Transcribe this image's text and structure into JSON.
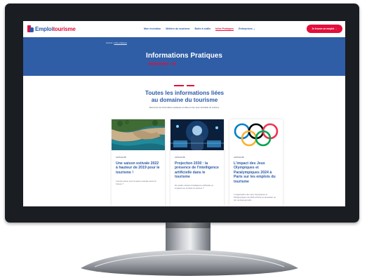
{
  "site": {
    "logo_part1": "Emploi",
    "logo_part2": "tourisme",
    "nav": [
      {
        "label": "Mon évolution"
      },
      {
        "label": "Métiers du tourisme"
      },
      {
        "label": "Boîte à outils"
      },
      {
        "label": "Infos Pratiques"
      },
      {
        "label": "Entreprises ⌄"
      }
    ],
    "cta_label": "Je trouve un emploi →"
  },
  "hero": {
    "breadcrumb_home": "Accueil ›",
    "breadcrumb_current": "Infos pratiques",
    "title": "Informations Pratiques"
  },
  "section": {
    "title": "Toutes les informations liées au domaine du tourisme",
    "subtitle": "Découvrez les informations pratiques et utiles en lien avec l'actualité du tourisme"
  },
  "cards": [
    {
      "tag": "ACTUALITÉ",
      "title": "Une saison estivale 2022 à hauteur de 2019 pour le tourisme !",
      "excerpt": "L'année pleine pour la saison estivale avant en France ?"
    },
    {
      "tag": "ACTUALITÉ",
      "title": "Projection 2030 : la présence de l'intelligence artificielle dans le tourisme",
      "excerpt": "De quelle manière l'intelligence artificielle va impacter les emplois du secteur ?"
    },
    {
      "tag": "ACTUALITÉ",
      "title": "L'impact des Jeux Olympiques et Paralympiques 2024 à Paris sur les emplois du tourisme",
      "excerpt": "L'organisation des Jeux Olympiques et Paralympiques de 2024 à Paris va nécessiter un fort recrutement afin..."
    }
  ],
  "colors": {
    "brand_blue": "#2c5aa8",
    "hero_blue": "#2f5ea6",
    "accent_red": "#e30f3c",
    "bezel": "#1a1d22"
  }
}
